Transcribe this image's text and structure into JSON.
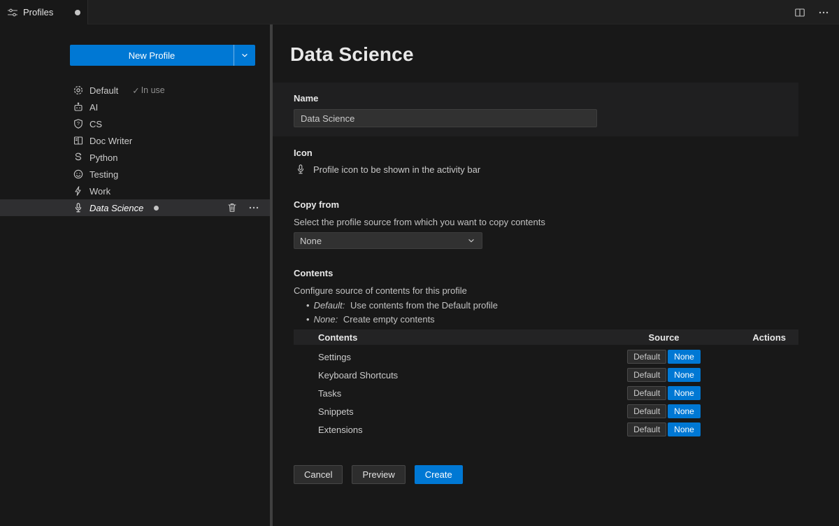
{
  "colors": {
    "accent": "#0078d4",
    "background": "#181818",
    "tab_strip": "#1f1f1f"
  },
  "icons": {
    "tab": "tune-icon",
    "tab_actions": [
      "split-editor-icon",
      "more-icon"
    ],
    "profiles": [
      "gear-icon",
      "robot-icon",
      "shield-icon",
      "book-icon",
      "snake-icon",
      "smiley-icon",
      "zap-icon",
      "mic-icon"
    ],
    "selected_row_actions": [
      "trash-icon",
      "more-icon"
    ],
    "misc": [
      "chevron-down-icon",
      "check-icon",
      "modified-dot",
      "mic-icon"
    ]
  },
  "tab_bar": {
    "tab_label": "Profiles"
  },
  "sidebar": {
    "new_profile_label": "New Profile",
    "profiles": [
      {
        "label": "Default",
        "badge_check": "✓",
        "badge": "In use"
      },
      {
        "label": "AI"
      },
      {
        "label": "CS"
      },
      {
        "label": "Doc Writer"
      },
      {
        "label": "Python"
      },
      {
        "label": "Testing"
      },
      {
        "label": "Work"
      },
      {
        "label": "Data Science",
        "selected": true,
        "modified": true
      }
    ]
  },
  "main": {
    "title": "Data Science",
    "name": {
      "label": "Name",
      "value": "Data Science"
    },
    "icon": {
      "label": "Icon",
      "description": "Profile icon to be shown in the activity bar"
    },
    "copy_from": {
      "label": "Copy from",
      "description": "Select the profile source from which you want to copy contents",
      "selected": "None"
    },
    "contents": {
      "label": "Contents",
      "description": "Configure source of contents for this profile",
      "bullets": [
        {
          "term": "Default:",
          "text": "Use contents from the Default profile"
        },
        {
          "term": "None:",
          "text": "Create empty contents"
        }
      ],
      "table": {
        "headers": {
          "contents": "Contents",
          "source": "Source",
          "actions": "Actions"
        },
        "rows": [
          {
            "name": "Settings",
            "default_label": "Default",
            "none_label": "None",
            "selected": "None"
          },
          {
            "name": "Keyboard Shortcuts",
            "default_label": "Default",
            "none_label": "None",
            "selected": "None"
          },
          {
            "name": "Tasks",
            "default_label": "Default",
            "none_label": "None",
            "selected": "None"
          },
          {
            "name": "Snippets",
            "default_label": "Default",
            "none_label": "None",
            "selected": "None"
          },
          {
            "name": "Extensions",
            "default_label": "Default",
            "none_label": "None",
            "selected": "None"
          }
        ]
      }
    },
    "footer": {
      "cancel_label": "Cancel",
      "preview_label": "Preview",
      "create_label": "Create"
    }
  }
}
